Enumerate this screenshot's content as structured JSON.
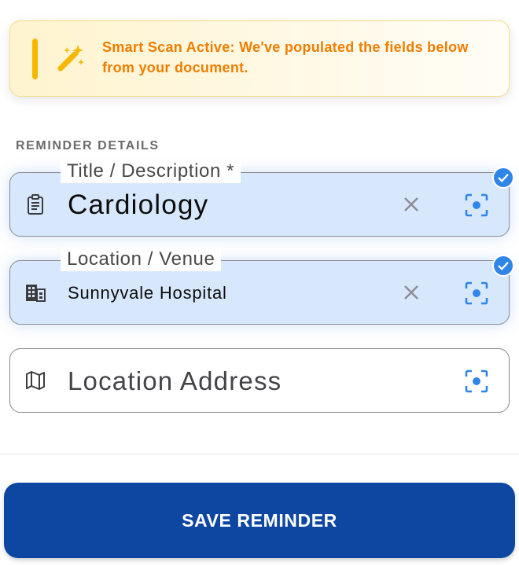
{
  "banner": {
    "line1": "Smart Scan Active: We've populated the fields below",
    "line2": "from your document.",
    "icon": "magic-wand-icon",
    "accent_color": "#f07d00"
  },
  "section": {
    "title": "REMINDER DETAILS"
  },
  "fields": {
    "title": {
      "label": "Title / Description *",
      "value": "Cardiology",
      "icon": "clipboard-icon",
      "autofilled": true
    },
    "location": {
      "label": "Location / Venue",
      "value": "Sunnyvale Hospital",
      "icon": "building-icon",
      "autofilled": true
    },
    "address": {
      "placeholder": "Location Address",
      "icon": "map-icon",
      "autofilled": false
    }
  },
  "actions": {
    "save_label": "SAVE REMINDER"
  },
  "colors": {
    "primary": "#0e47a1",
    "autofill_bg": "#d7e8fd",
    "scan_icon": "#2f86e8",
    "check_badge": "#2f86e8"
  }
}
